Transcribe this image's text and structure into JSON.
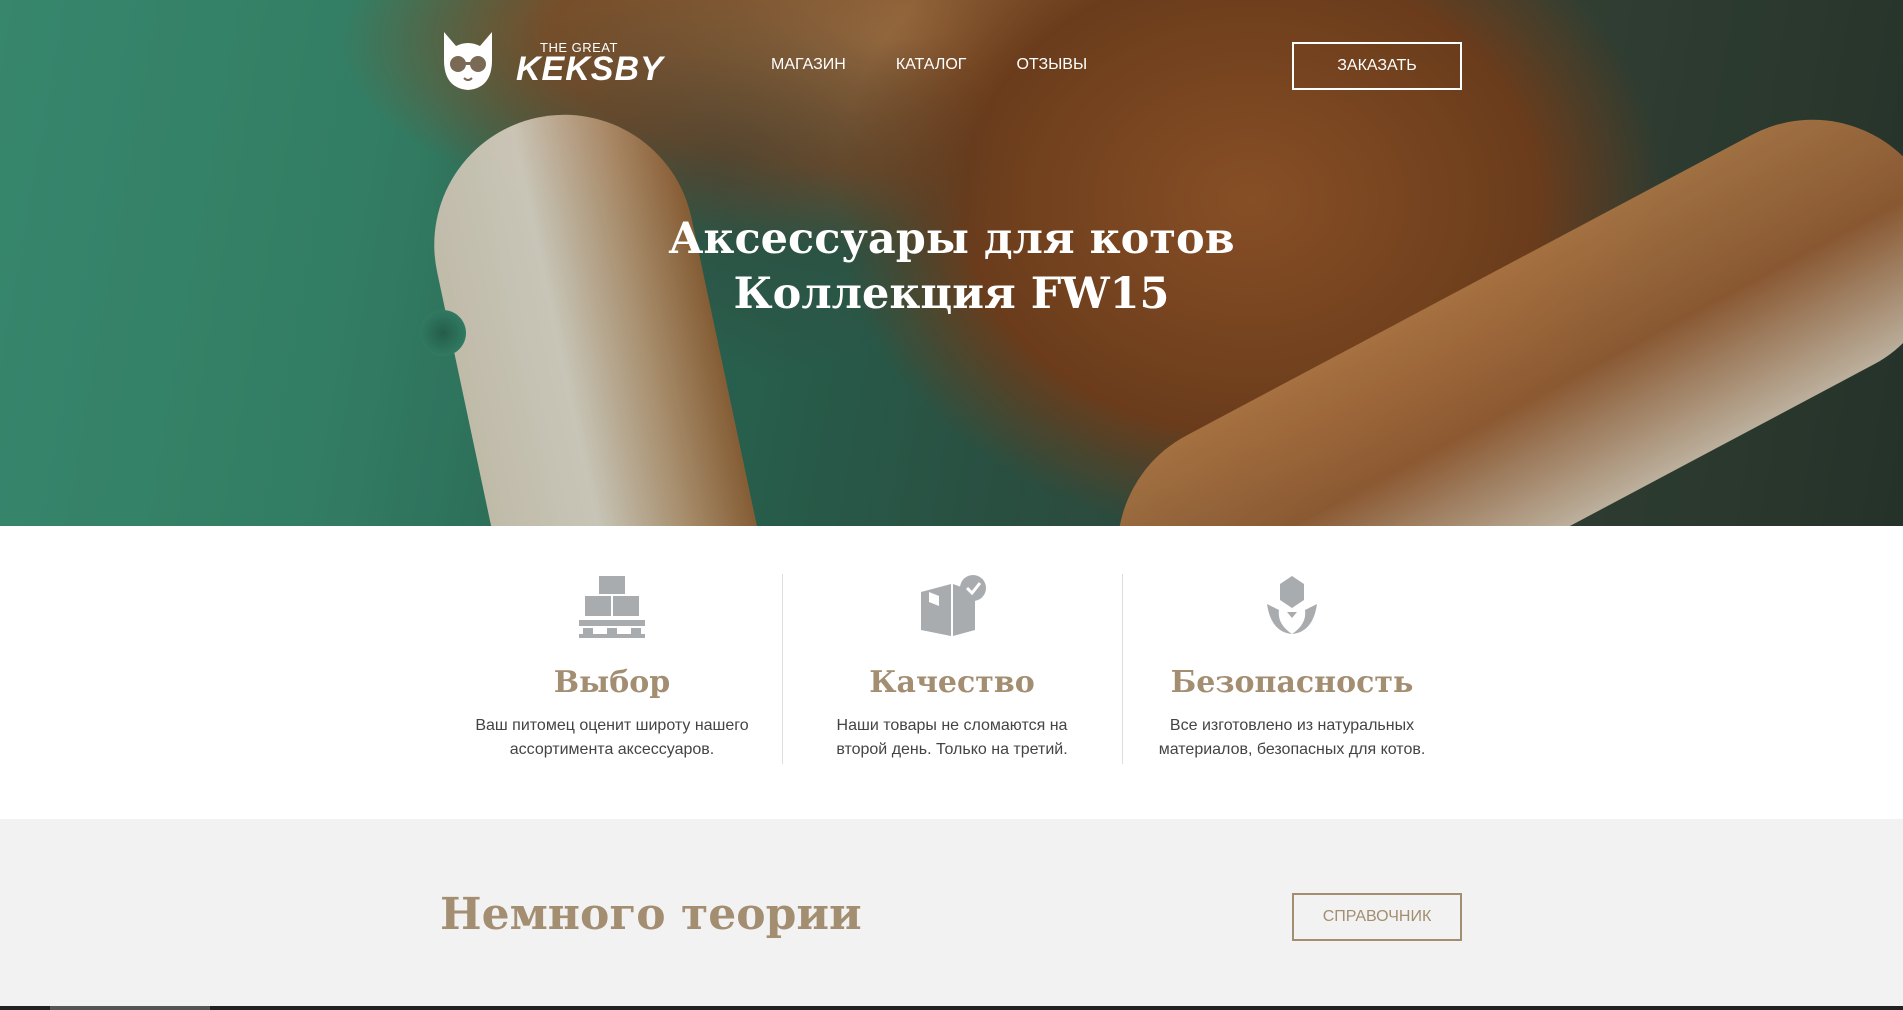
{
  "header": {
    "logo": {
      "small_text": "THE GREAT",
      "brand": "KEKSBY"
    },
    "nav": [
      "МАГАЗИН",
      "КАТАЛОГ",
      "ОТЗЫВЫ"
    ],
    "order_button": "ЗАКАЗАТЬ"
  },
  "hero": {
    "title_line1": "Аксессуары для котов",
    "title_line2": "Коллекция FW15"
  },
  "features": [
    {
      "icon": "pallet-boxes-icon",
      "title": "Выбор",
      "text_line1": "Ваш питомец оценит широту нашего",
      "text_line2": "ассортимента аксессуаров."
    },
    {
      "icon": "box-check-icon",
      "title": "Качество",
      "text_line1": "Наши товары не сломаются на",
      "text_line2": "второй день. Только на третий."
    },
    {
      "icon": "leaf-hand-icon",
      "title": "Безопасность",
      "text_line1": "Все изготовлено из натуральных",
      "text_line2": "материалов, безопасных для котов."
    }
  ],
  "theory": {
    "title": "Немного теории",
    "reference_button": "СПРАВОЧНИК"
  },
  "colors": {
    "accent": "#a38e71",
    "text": "#444444",
    "section_bg": "#f2f2f2"
  }
}
